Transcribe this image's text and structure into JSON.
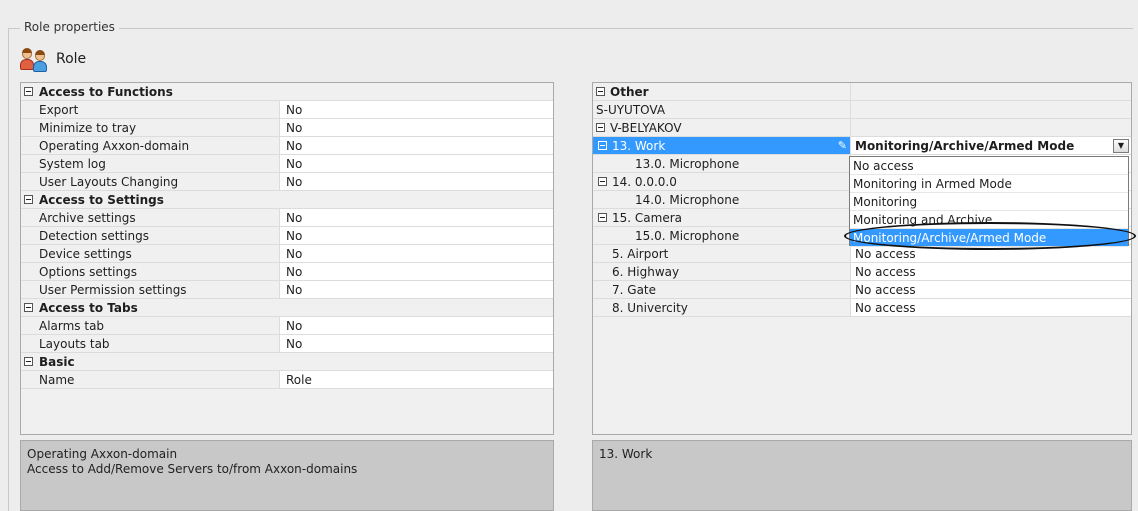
{
  "group_title": "Role properties",
  "role_label": "Role",
  "left_grid": {
    "categories": [
      {
        "title": "Access to Functions",
        "rows": [
          {
            "name": "Export",
            "value": "No"
          },
          {
            "name": "Minimize to tray",
            "value": "No"
          },
          {
            "name": "Operating Axxon-domain",
            "value": "No"
          },
          {
            "name": "System log",
            "value": "No"
          },
          {
            "name": "User Layouts Changing",
            "value": "No"
          }
        ]
      },
      {
        "title": "Access to Settings",
        "rows": [
          {
            "name": "Archive settings",
            "value": "No"
          },
          {
            "name": "Detection settings",
            "value": "No"
          },
          {
            "name": "Device settings",
            "value": "No"
          },
          {
            "name": "Options settings",
            "value": "No"
          },
          {
            "name": "User Permission settings",
            "value": "No"
          }
        ]
      },
      {
        "title": "Access to Tabs",
        "rows": [
          {
            "name": "Alarms tab",
            "value": "No"
          },
          {
            "name": "Layouts tab",
            "value": "No"
          }
        ]
      },
      {
        "title": "Basic",
        "rows": [
          {
            "name": "Name",
            "value": "Role"
          }
        ]
      }
    ]
  },
  "right_grid": {
    "rows": [
      {
        "name": "Other",
        "value": ""
      },
      {
        "name": "S-UYUTOVA",
        "value": ""
      },
      {
        "name": "V-BELYAKOV",
        "value": ""
      },
      {
        "name": "13. Work",
        "value": "Monitoring/Archive/Armed Mode"
      },
      {
        "name": "13.0. Microphone",
        "value": ""
      },
      {
        "name": "14. 0.0.0.0",
        "value": ""
      },
      {
        "name": "14.0. Microphone",
        "value": ""
      },
      {
        "name": "15. Camera",
        "value": ""
      },
      {
        "name": "15.0. Microphone",
        "value": ""
      },
      {
        "name": "5. Airport",
        "value": "No access"
      },
      {
        "name": "6. Highway",
        "value": "No access"
      },
      {
        "name": "7. Gate",
        "value": "No access"
      },
      {
        "name": "8. Univercity",
        "value": "No access"
      }
    ]
  },
  "dropdown": {
    "options": [
      "No access",
      "Monitoring in Armed Mode",
      "Monitoring",
      "Monitoring and Archive",
      "Monitoring/Archive/Armed Mode"
    ],
    "selected": "Monitoring/Archive/Armed Mode"
  },
  "desc_left": {
    "title": "Operating Axxon-domain",
    "text": "Access to Add/Remove Servers to/from Axxon-domains"
  },
  "desc_right": {
    "title": "13. Work"
  },
  "colors": {
    "selection": "#3399ff",
    "description_bg": "#c8c8c8"
  }
}
